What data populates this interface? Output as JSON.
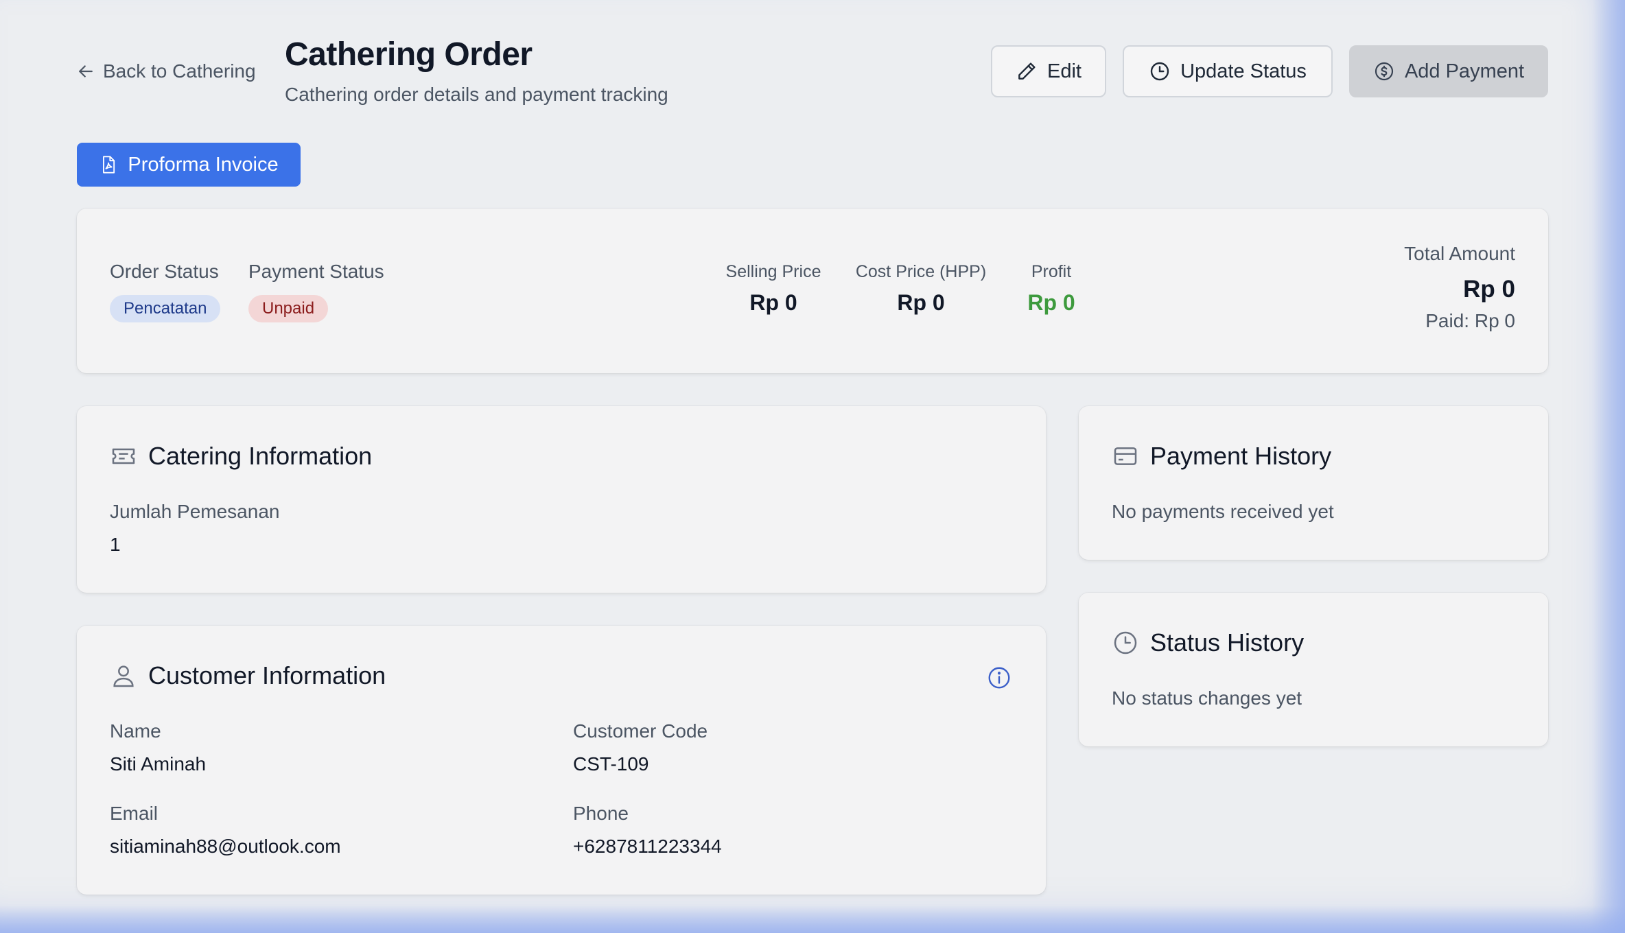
{
  "header": {
    "back_label": "Back to Cathering",
    "title": "Cathering Order",
    "subtitle": "Cathering order details and payment tracking",
    "edit_label": "Edit",
    "update_status_label": "Update Status",
    "add_payment_label": "Add Payment",
    "invoice_label": "Proforma Invoice"
  },
  "summary": {
    "order_status_label": "Order Status",
    "order_status": "Pencatatan",
    "payment_status_label": "Payment Status",
    "payment_status": "Unpaid",
    "selling_price_label": "Selling Price",
    "selling_price": "Rp 0",
    "cost_price_label": "Cost Price (HPP)",
    "cost_price": "Rp 0",
    "profit_label": "Profit",
    "profit": "Rp 0",
    "total_amount_label": "Total Amount",
    "total_amount": "Rp 0",
    "paid": "Paid: Rp 0"
  },
  "catering": {
    "title": "Catering Information",
    "qty_label": "Jumlah Pemesanan",
    "qty_value": "1"
  },
  "customer": {
    "title": "Customer Information",
    "name_label": "Name",
    "name": "Siti Aminah",
    "code_label": "Customer Code",
    "code": "CST-109",
    "email_label": "Email",
    "email": "sitiaminah88@outlook.com",
    "phone_label": "Phone",
    "phone": "+6287811223344"
  },
  "payment_history": {
    "title": "Payment History",
    "empty": "No payments received yet"
  },
  "status_history": {
    "title": "Status History",
    "empty": "No status changes yet"
  },
  "colors": {
    "primary": "#3b72e8",
    "profit": "#3d9a3d",
    "badge_blue_bg": "#d7e1f5",
    "badge_red_bg": "#f3d6d6"
  }
}
